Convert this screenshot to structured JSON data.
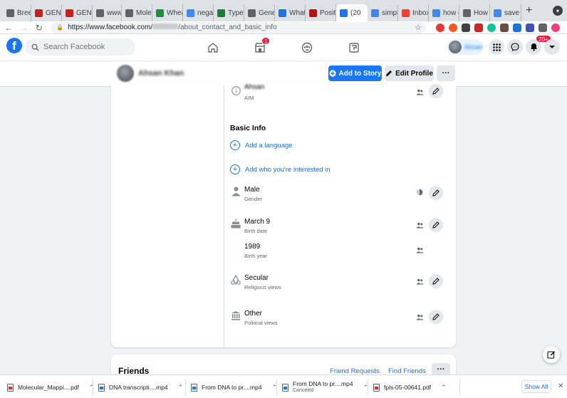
{
  "browser": {
    "tabs": [
      {
        "label": "Breed",
        "color": "#5f6368"
      },
      {
        "label": "GENE",
        "color": "#c5221f"
      },
      {
        "label": "GENE",
        "color": "#c5221f"
      },
      {
        "label": "www.",
        "color": "#5f6368"
      },
      {
        "label": "Molec",
        "color": "#5f6368"
      },
      {
        "label": "Whea",
        "color": "#1e8e3e"
      },
      {
        "label": "negati",
        "color": "#4285f4"
      },
      {
        "label": "Types",
        "color": "#188038"
      },
      {
        "label": "Gene",
        "color": "#5f6368"
      },
      {
        "label": "What",
        "color": "#1a73e8"
      },
      {
        "label": "Positi",
        "color": "#b31412"
      },
      {
        "label": "(20",
        "color": "#1877f2"
      },
      {
        "label": "simple",
        "color": "#4285f4"
      },
      {
        "label": "Inbox",
        "color": "#ea4335"
      },
      {
        "label": "how c",
        "color": "#4285f4"
      },
      {
        "label": "How T",
        "color": "#5f6368"
      },
      {
        "label": "save v",
        "color": "#4285f4"
      }
    ],
    "active_tab_index": 11,
    "url_host": "https://www.facebook.com/",
    "url_path": "/about_contact_and_basic_info"
  },
  "fb": {
    "search_placeholder": "Search Facebook",
    "marketplace_badge": "1",
    "notifications_badge": "20+",
    "profile_chip_name": "Ahsan",
    "accent": "#1877f2"
  },
  "profile": {
    "name": "Ahsan Khan",
    "add_story_label": "Add to Story",
    "edit_profile_label": "Edit Profile",
    "more_label": "···"
  },
  "about": {
    "top_item": {
      "value": "Ahsan",
      "label": "AIM"
    },
    "section_title": "Basic Info",
    "add_language": "Add a language",
    "add_interested": "Add who you're interested in",
    "gender": {
      "value": "Male",
      "label": "Gender"
    },
    "birth_date": {
      "value": "March 9",
      "label": "Birth date"
    },
    "birth_year": {
      "value": "1989",
      "label": "Birth year"
    },
    "religion": {
      "value": "Secular",
      "label": "Religious views"
    },
    "political": {
      "value": "Other",
      "label": "Political views"
    }
  },
  "friends": {
    "title": "Friends",
    "requests": "Friend Requests",
    "find": "Find Friends",
    "more": "···"
  },
  "downloads": {
    "items": [
      {
        "name": "Molecular_Mappi....pdf",
        "type": "pdf",
        "status": ""
      },
      {
        "name": "DNA transcripti....mp4",
        "type": "mp4",
        "status": ""
      },
      {
        "name": "From DNA to pr....mp4",
        "type": "mp4",
        "status": ""
      },
      {
        "name": "From DNA to pr....mp4",
        "type": "mp4",
        "status": "Canceled"
      },
      {
        "name": "fpls-05-00641.pdf",
        "type": "pdf",
        "status": ""
      }
    ],
    "show_all": "Show All"
  }
}
